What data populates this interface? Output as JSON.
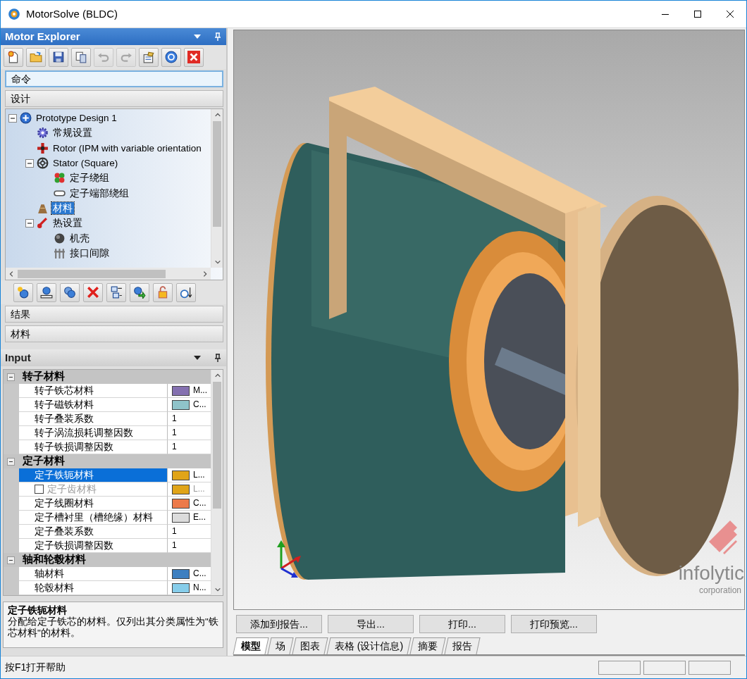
{
  "window": {
    "title": "MotorSolve (BLDC)"
  },
  "explorer": {
    "title": "Motor Explorer",
    "toolbar": [
      {
        "kind": "new",
        "disabled": false
      },
      {
        "kind": "open",
        "disabled": false
      },
      {
        "kind": "save",
        "disabled": false
      },
      {
        "kind": "copy",
        "disabled": false
      },
      {
        "kind": "undo",
        "disabled": true
      },
      {
        "kind": "redo",
        "disabled": true
      },
      {
        "kind": "properties",
        "disabled": false
      },
      {
        "kind": "help",
        "disabled": false
      },
      {
        "kind": "close",
        "disabled": false
      }
    ],
    "sections_top": [
      {
        "label": "命令",
        "selected": true
      },
      {
        "label": "设计",
        "selected": false
      }
    ],
    "tree": [
      {
        "label": "Prototype Design 1",
        "kind": "design",
        "expanded": true,
        "selected": false,
        "children": [
          {
            "label": "常规设置",
            "kind": "gear",
            "selected": false
          },
          {
            "label": "Rotor (IPM with variable orientation",
            "kind": "rotor",
            "selected": false
          },
          {
            "label": "Stator (Square)",
            "kind": "stator",
            "expanded": true,
            "selected": false,
            "children": [
              {
                "label": "定子绕组",
                "kind": "winding",
                "selected": false
              },
              {
                "label": "定子端部绕组",
                "kind": "endwinding",
                "selected": false
              }
            ]
          },
          {
            "label": "材料",
            "kind": "materials",
            "selected": true
          },
          {
            "label": "热设置",
            "kind": "thermal",
            "expanded": true,
            "selected": false,
            "children": [
              {
                "label": "机壳",
                "kind": "housing",
                "selected": false
              },
              {
                "label": "接口间隙",
                "kind": "gap",
                "selected": false
              }
            ]
          }
        ]
      }
    ],
    "tree_toolbar": [
      {
        "kind": "add"
      },
      {
        "kind": "ruler"
      },
      {
        "kind": "duplicate"
      },
      {
        "kind": "delete"
      },
      {
        "kind": "list"
      },
      {
        "kind": "export"
      },
      {
        "kind": "lock"
      },
      {
        "kind": "timer"
      }
    ],
    "sections_bottom": [
      {
        "label": "结果",
        "selected": false
      },
      {
        "label": "材料",
        "selected": false
      }
    ]
  },
  "input": {
    "title": "Input",
    "categories": [
      {
        "label": "转子材料",
        "expanded": true,
        "rows": [
          {
            "name": "转子铁芯材料",
            "kind": "material",
            "color": "#8470b0",
            "value": "M...",
            "selected": false,
            "disabled": false
          },
          {
            "name": "转子磁铁材料",
            "kind": "material",
            "color": "#8fc3c9",
            "value": "C...",
            "selected": false,
            "disabled": false
          },
          {
            "name": "转子叠装系数",
            "kind": "number",
            "value": "1",
            "selected": false,
            "disabled": false
          },
          {
            "name": "转子涡流损耗调整因数",
            "kind": "number",
            "value": "1",
            "selected": false,
            "disabled": false
          },
          {
            "name": "转子铁损调整因数",
            "kind": "number",
            "value": "1",
            "selected": false,
            "disabled": false
          }
        ]
      },
      {
        "label": "定子材料",
        "expanded": true,
        "rows": [
          {
            "name": "定子铁轭材料",
            "kind": "material",
            "color": "#e0a418",
            "value": "L...",
            "selected": true,
            "disabled": false
          },
          {
            "name": "定子齿材料",
            "kind": "checkbox",
            "checked": false,
            "color": "#e0a418",
            "value": "L...",
            "selected": false,
            "disabled": true
          },
          {
            "name": "定子线圈材料",
            "kind": "material",
            "color": "#ec7a4a",
            "value": "C...",
            "selected": false,
            "disabled": false
          },
          {
            "name": "定子槽衬里（槽绝缘）材料",
            "kind": "material",
            "color": "#dcdcdc",
            "value": "E...",
            "selected": false,
            "disabled": false
          },
          {
            "name": "定子叠装系数",
            "kind": "number",
            "value": "1",
            "selected": false,
            "disabled": false
          },
          {
            "name": "定子铁损调整因数",
            "kind": "number",
            "value": "1",
            "selected": false,
            "disabled": false
          }
        ]
      },
      {
        "label": "轴和轮毂材料",
        "expanded": true,
        "rows": [
          {
            "name": "轴材料",
            "kind": "material",
            "color": "#3d7fc0",
            "value": "C...",
            "selected": false,
            "disabled": false
          },
          {
            "name": "轮毂材料",
            "kind": "material",
            "color": "#86cdea",
            "value": "N...",
            "selected": false,
            "disabled": false
          }
        ]
      }
    ]
  },
  "description": {
    "title": "定子铁轭材料",
    "text": "分配给定子铁芯的材料。仅列出其分类属性为\"铁芯材料\"的材料。"
  },
  "viewport": {
    "logo_name": "infolytic",
    "logo_tagline": "corporation"
  },
  "actions": [
    "添加到报告...",
    "导出...",
    "打印...",
    "打印预览..."
  ],
  "tabs": [
    {
      "label": "模型",
      "selected": true
    },
    {
      "label": "场",
      "selected": false
    },
    {
      "label": "图表",
      "selected": false
    },
    {
      "label": "表格 (设计信息)",
      "selected": false
    },
    {
      "label": "摘要",
      "selected": false
    },
    {
      "label": "报告",
      "selected": false
    }
  ],
  "status_bar": {
    "text": "按F1打开帮助"
  }
}
